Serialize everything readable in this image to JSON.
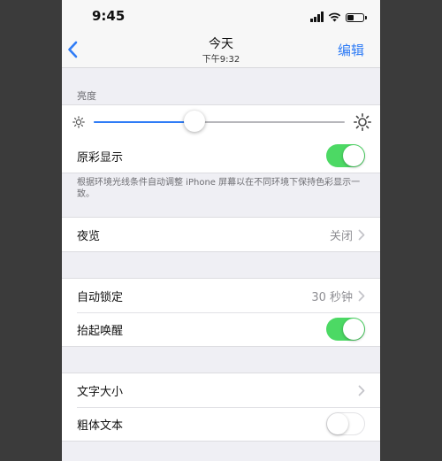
{
  "status_bar": {
    "time": "9:45"
  },
  "nav": {
    "title": "今天",
    "subtitle": "下午9:32",
    "action_label": "编辑"
  },
  "brightness": {
    "header": "亮度",
    "level": 0.4
  },
  "true_tone": {
    "label": "原彩显示",
    "on": true,
    "footnote": "根据环境光线条件自动调整 iPhone 屏幕以在不同环境下保持色彩显示一致。"
  },
  "night_shift": {
    "label": "夜览",
    "value": "关闭"
  },
  "auto_lock": {
    "label": "自动锁定",
    "value": "30 秒钟"
  },
  "raise_to_wake": {
    "label": "抬起唤醒",
    "on": true
  },
  "text_size": {
    "label": "文字大小"
  },
  "bold_text": {
    "label": "粗体文本",
    "on": false
  },
  "colors": {
    "accent": "#2f7cf6",
    "toggle_on": "#4cd964",
    "background": "#efeff4"
  }
}
